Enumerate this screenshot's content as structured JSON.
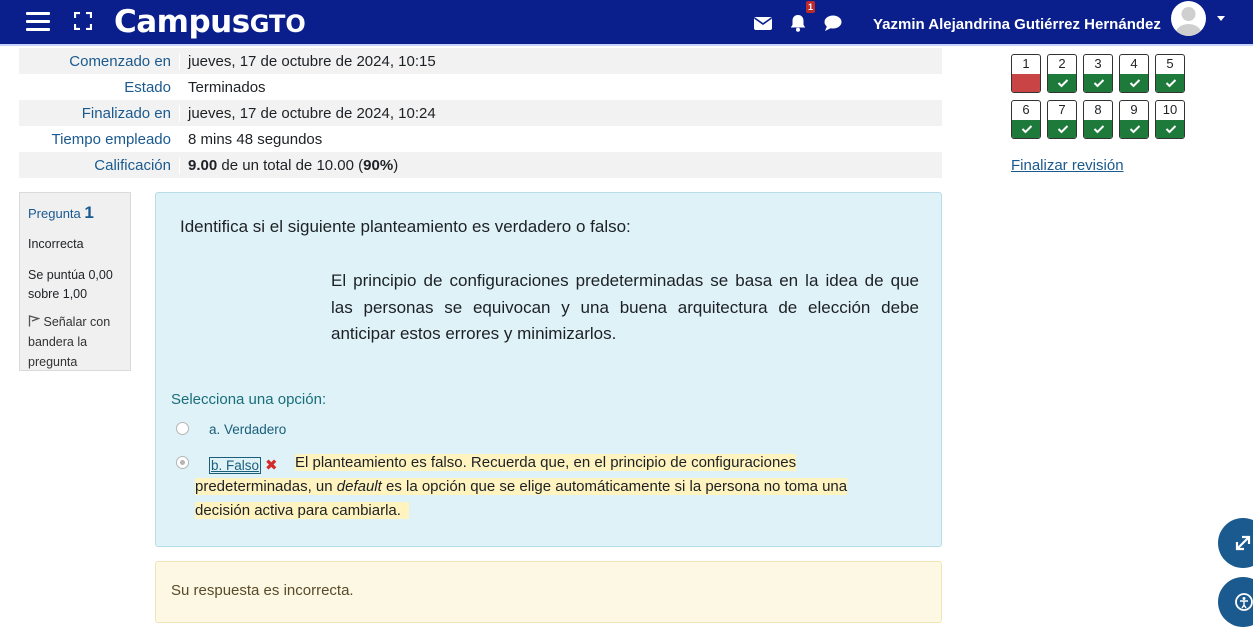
{
  "navbar": {
    "logo_main": "Campus",
    "logo_suffix": "GTO",
    "notifications_count": "1",
    "username": "Yazmin Alejandrina Gutiérrez Hernández"
  },
  "summary": {
    "rows": [
      {
        "label": "Comenzado en",
        "value": "jueves, 17 de octubre de 2024, 10:15"
      },
      {
        "label": "Estado",
        "value": "Terminados"
      },
      {
        "label": "Finalizado en",
        "value": "jueves, 17 de octubre de 2024, 10:24"
      },
      {
        "label": "Tiempo empleado",
        "value": "8 mins 48 segundos"
      }
    ],
    "grade_label": "Calificación",
    "grade_score": "9.00",
    "grade_mid": " de un total de 10.00 (",
    "grade_percent": "90%",
    "grade_end": ")"
  },
  "question_info": {
    "label": "Pregunta",
    "number": "1",
    "state": "Incorrecta",
    "score": "Se puntúa 0,00 sobre 1,00",
    "flag": "Señalar con bandera la pregunta"
  },
  "question": {
    "instruction": "Identifica si el siguiente planteamiento es verdadero o falso:",
    "statement": "El principio de configuraciones predeterminadas se basa en la idea de que las personas se equivocan y una buena arquitectura de elección debe anticipar estos errores y minimizarlos.",
    "prompt": "Selecciona una opción:",
    "option_a": "a. Verdadero",
    "option_b": "b. Falso",
    "feedback_1": "El planteamiento es falso. Recuerda que, en el principio de configuraciones predeterminadas, un ",
    "feedback_em": "default",
    "feedback_2": " es la opción que se elige automáticamente si la persona no toma una decisión activa para cambiarla."
  },
  "outcome": "Su respuesta es incorrecta.",
  "quiz_nav": {
    "buttons": [
      {
        "n": "1",
        "status": "incorrect"
      },
      {
        "n": "2",
        "status": "correct"
      },
      {
        "n": "3",
        "status": "correct"
      },
      {
        "n": "4",
        "status": "correct"
      },
      {
        "n": "5",
        "status": "correct"
      },
      {
        "n": "6",
        "status": "correct"
      },
      {
        "n": "7",
        "status": "correct"
      },
      {
        "n": "8",
        "status": "correct"
      },
      {
        "n": "9",
        "status": "correct"
      },
      {
        "n": "10",
        "status": "correct"
      }
    ],
    "finish_label": "Finalizar revisión"
  },
  "colors": {
    "navbar": "#0a1e8c",
    "correct": "#1e7a3a",
    "incorrect": "#c94444",
    "link": "#1b5a8f"
  }
}
